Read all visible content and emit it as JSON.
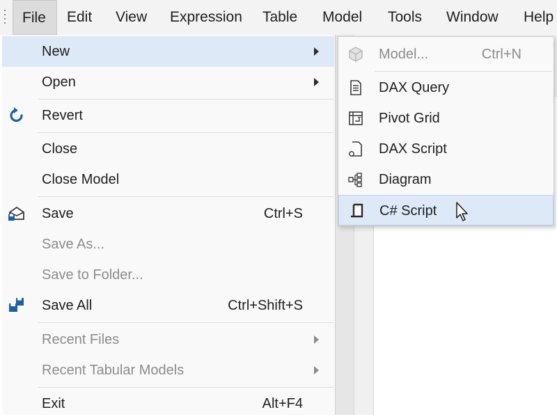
{
  "menubar": {
    "items": [
      {
        "label": "File",
        "active": true
      },
      {
        "label": "Edit"
      },
      {
        "label": "View"
      },
      {
        "label": "Expression"
      },
      {
        "label": "Table"
      },
      {
        "label": "Model"
      },
      {
        "label": "Tools"
      },
      {
        "label": "Window"
      },
      {
        "label": "Help"
      }
    ]
  },
  "file_menu": {
    "items": [
      {
        "label": "New",
        "submenu": true,
        "highlighted": true
      },
      {
        "label": "Open",
        "submenu": true
      },
      {
        "label": "Revert",
        "icon": "revert-icon"
      },
      {
        "label": "Close"
      },
      {
        "label": "Close Model"
      },
      {
        "label": "Save",
        "shortcut": "Ctrl+S",
        "icon": "save-icon"
      },
      {
        "label": "Save As...",
        "disabled": true
      },
      {
        "label": "Save to Folder...",
        "disabled": true
      },
      {
        "label": "Save All",
        "shortcut": "Ctrl+Shift+S",
        "icon": "save-all-icon"
      },
      {
        "label": "Recent Files",
        "submenu": true,
        "disabled": true
      },
      {
        "label": "Recent Tabular Models",
        "submenu": true,
        "disabled": true
      },
      {
        "label": "Exit",
        "shortcut": "Alt+F4"
      }
    ]
  },
  "new_submenu": {
    "items": [
      {
        "label": "Model...",
        "shortcut": "Ctrl+N",
        "disabled": true,
        "icon": "cube-icon"
      },
      {
        "label": "DAX Query",
        "icon": "document-icon"
      },
      {
        "label": "Pivot Grid",
        "icon": "pivot-grid-icon"
      },
      {
        "label": "DAX Script",
        "icon": "script-file-icon"
      },
      {
        "label": "Diagram",
        "icon": "diagram-icon"
      },
      {
        "label": "C# Script",
        "icon": "csharp-script-icon",
        "highlighted": true
      }
    ]
  },
  "colors": {
    "highlight": "#dde9f7",
    "disabled_text": "#8c8c8c",
    "icon_blue": "#1a5fa8"
  }
}
